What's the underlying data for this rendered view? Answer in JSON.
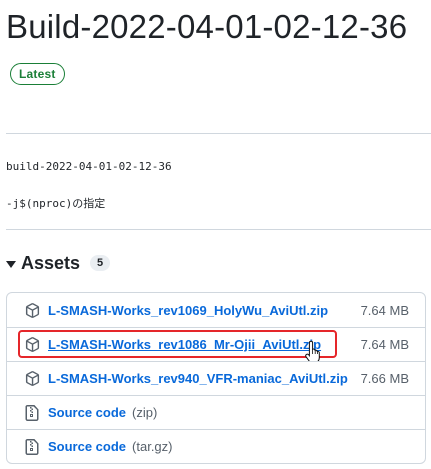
{
  "release": {
    "title": "Build-2022-04-01-02-12-36",
    "badge": "Latest",
    "tag": "build-2022-04-01-02-12-36",
    "notes": "-j$(nproc)の指定"
  },
  "assets": {
    "title": "Assets",
    "count": "5",
    "items": [
      {
        "name": "L-SMASH-Works_rev1069_HolyWu_AviUtl.zip",
        "size": "7.64 MB",
        "icon": "package-icon"
      },
      {
        "name": "L-SMASH-Works_rev1086_Mr-Ojii_AviUtl.zip",
        "size": "7.64 MB",
        "icon": "package-icon"
      },
      {
        "name": "L-SMASH-Works_rev940_VFR-maniac_AviUtl.zip",
        "size": "7.66 MB",
        "icon": "package-icon"
      },
      {
        "name": "Source code",
        "ext": "(zip)",
        "icon": "file-zip-icon"
      },
      {
        "name": "Source code",
        "ext": "(tar.gz)",
        "icon": "file-zip-icon"
      }
    ]
  },
  "colors": {
    "link": "#0969da",
    "latest": "#1a7f37",
    "highlight": "#e5262a"
  }
}
